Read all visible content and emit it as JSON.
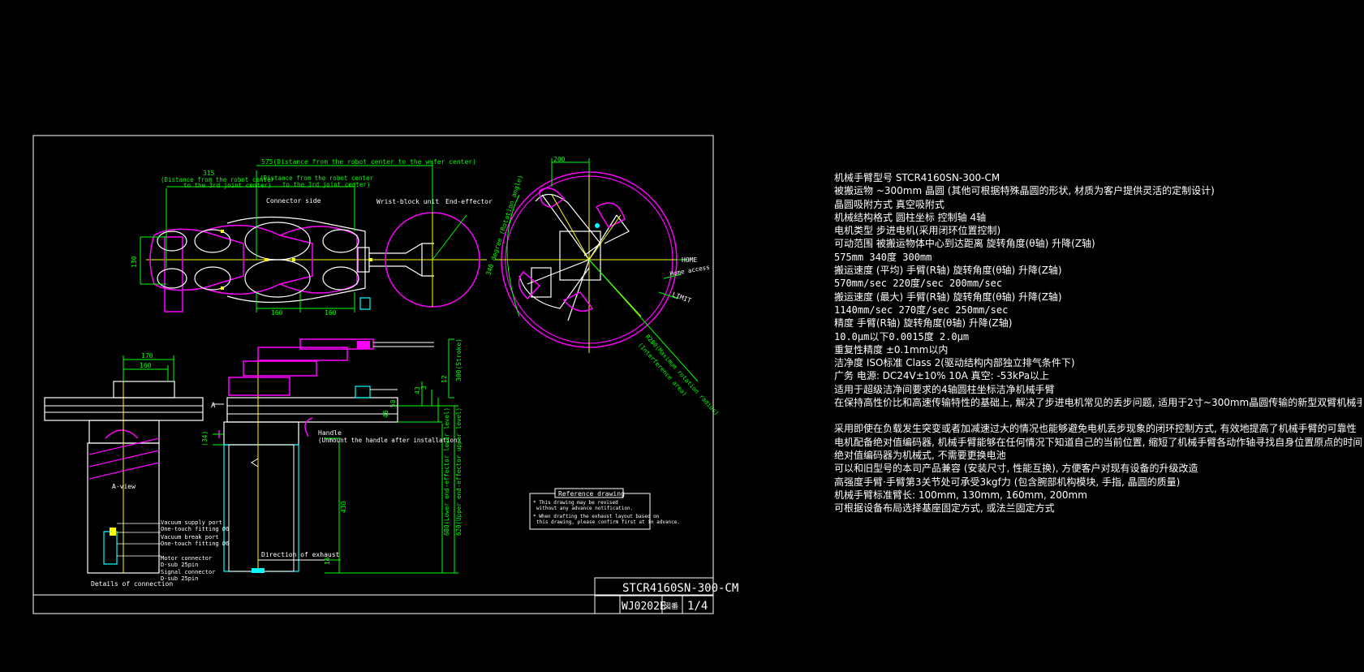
{
  "colors": {
    "background": "#000000",
    "frame": "#ffffff",
    "dimension": "#00ff00",
    "body": "#ffffff",
    "arm": "#ff00ff",
    "centerline": "#ffff00",
    "connector": "#00ffff"
  },
  "title_block": {
    "model": "STCR4160SN-300-CM",
    "code": "WJ0202E",
    "sheet": "1/4",
    "small_label": "図番"
  },
  "drawing_labels": {
    "dist_575": "575(Distance from the robot center to the wafer center)",
    "dist_315": "315",
    "dist_315_note": "(Distance from the robot center",
    "dist_315_note2": "to the 3rd joint center)",
    "dist_315b_note": "(Distance from the robot center",
    "dist_315b_note2": "to the 3rd joint center)",
    "connector_side": "Connector side",
    "wrist_block": "Wrist-block unit",
    "end_effector": "End-effector",
    "dim_130": "130",
    "dim_160a": "160",
    "dim_160b": "160",
    "dim_200": "200",
    "rotation_angle": "340 degree (Rotation angle)",
    "home": "HOME",
    "home_access": "Home access",
    "limit": "LIMIT",
    "max_radius": "R280(Maximum rotation radius)",
    "interference": "(Interference area)",
    "dim_170": "170",
    "dim_160c": "160",
    "a_arrow": "A",
    "a_view": "A-view",
    "handle": "Handle",
    "handle_note": "(Unmount the handle after installation)",
    "dim_300": "300(Stroke)",
    "dim_12": "12",
    "dim_3": "3",
    "dim_43": "43",
    "dim_58": "58",
    "dim_46": "46",
    "dim_34": "(34)",
    "upper_level": "620(Upper end-effector upper level)",
    "lower_level": "680(Lower end-effector lower level)",
    "dim_430": "430",
    "dim_15": "15",
    "vacuum_supply": "Vacuum supply port",
    "vacuum_supply_note": "One-touch fitting Ø6",
    "vacuum_break": "Vacuum break port",
    "vacuum_break_note": "One-touch fitting Ø6",
    "motor_connector": "Motor connector",
    "motor_connector_note": "D-sub 25pin",
    "signal_connector": "Signal connector",
    "signal_connector_note": "D-sub 25pin",
    "details": "Details of connection",
    "exhaust": "Direction of exhaust",
    "reference_title": "Reference drawing",
    "reference_line1": "* This drawing may be revised",
    "reference_line2": "without any advance notification.",
    "reference_line3": "* When drafting the exhaust layout based on",
    "reference_line4": "this drawing, please confirm first at in advance."
  },
  "spec": {
    "l1": "机械手臂型号    STCR4160SN-300-CM",
    "l2": "被搬运物  ~300mm 晶圆 (其他可根据特殊晶圆的形状, 材质为客户提供灵活的定制设计)",
    "l3": "晶圆吸附方式       真空吸附式",
    "l4": "机械结构格式      圆柱坐标    控制轴      4轴",
    "l5": "电机类型   步进电机(采用闭环位置控制)",
    "l6": "可动范围    被搬运物体中心到达距离 旋转角度(θ轴)    升降(Z轴)",
    "l7": "575mm     340度      300mm",
    "l8": "搬运速度 (平均) 手臂(R轴)  旋转角度(θ轴)    升降(Z轴)",
    "l9": "570mm/sec     220度/sec      200mm/sec",
    "l10": "搬运速度 (最大) 手臂(R轴)  旋转角度(θ轴)    升降(Z轴)",
    "l11": "1140mm/sec    270度/sec      250mm/sec",
    "l12": "精度  手臂(R轴)   旋转角度(θ轴)     升降(Z轴)",
    "l13": "10.0μm以下0.0015度   2.0μm",
    "l14": "重复性精度 ±0.1mm以内",
    "l15": "洁净度    ISO标准 Class 2(驱动结构内部独立排气条件下)",
    "l16": "广务  电源: DC24V±10% 10A      真空: -53kPa以上",
    "l17": "适用于超级洁净间要求的4轴圆柱坐标洁净机械手臂",
    "l18": "在保持高性价比和高速传输特性的基础上, 解决了步进电机常见的丢步问题, 适用于2寸~300mm晶圆传输的新型双臂机械手",
    "l19": "采用即使在负载发生突变或者加减速过大的情况也能够避免电机丢步现象的闭环控制方式, 有效地提高了机械手臂的可靠性",
    "l20": "电机配备绝对值编码器, 机械手臂能够在任何情况下知道自己的当前位置, 缩短了机械手臂各动作轴寻找自身位置原点的时间",
    "l21": "绝对值编码器为机械式, 不需要更换电池",
    "l22": "可以和旧型号的本司产品兼容 (安装尺寸, 性能互换), 方便客户对现有设备的升级改造",
    "l23": "高强度手臂·手臂第3关节处可承受3kgf力 (包含腕部机构模块, 手指, 晶圆的质量)",
    "l24": "机械手臂标准臂长: 100mm, 130mm, 160mm, 200mm",
    "l25": "可根据设备布局选择基座固定方式, 或法兰固定方式"
  }
}
